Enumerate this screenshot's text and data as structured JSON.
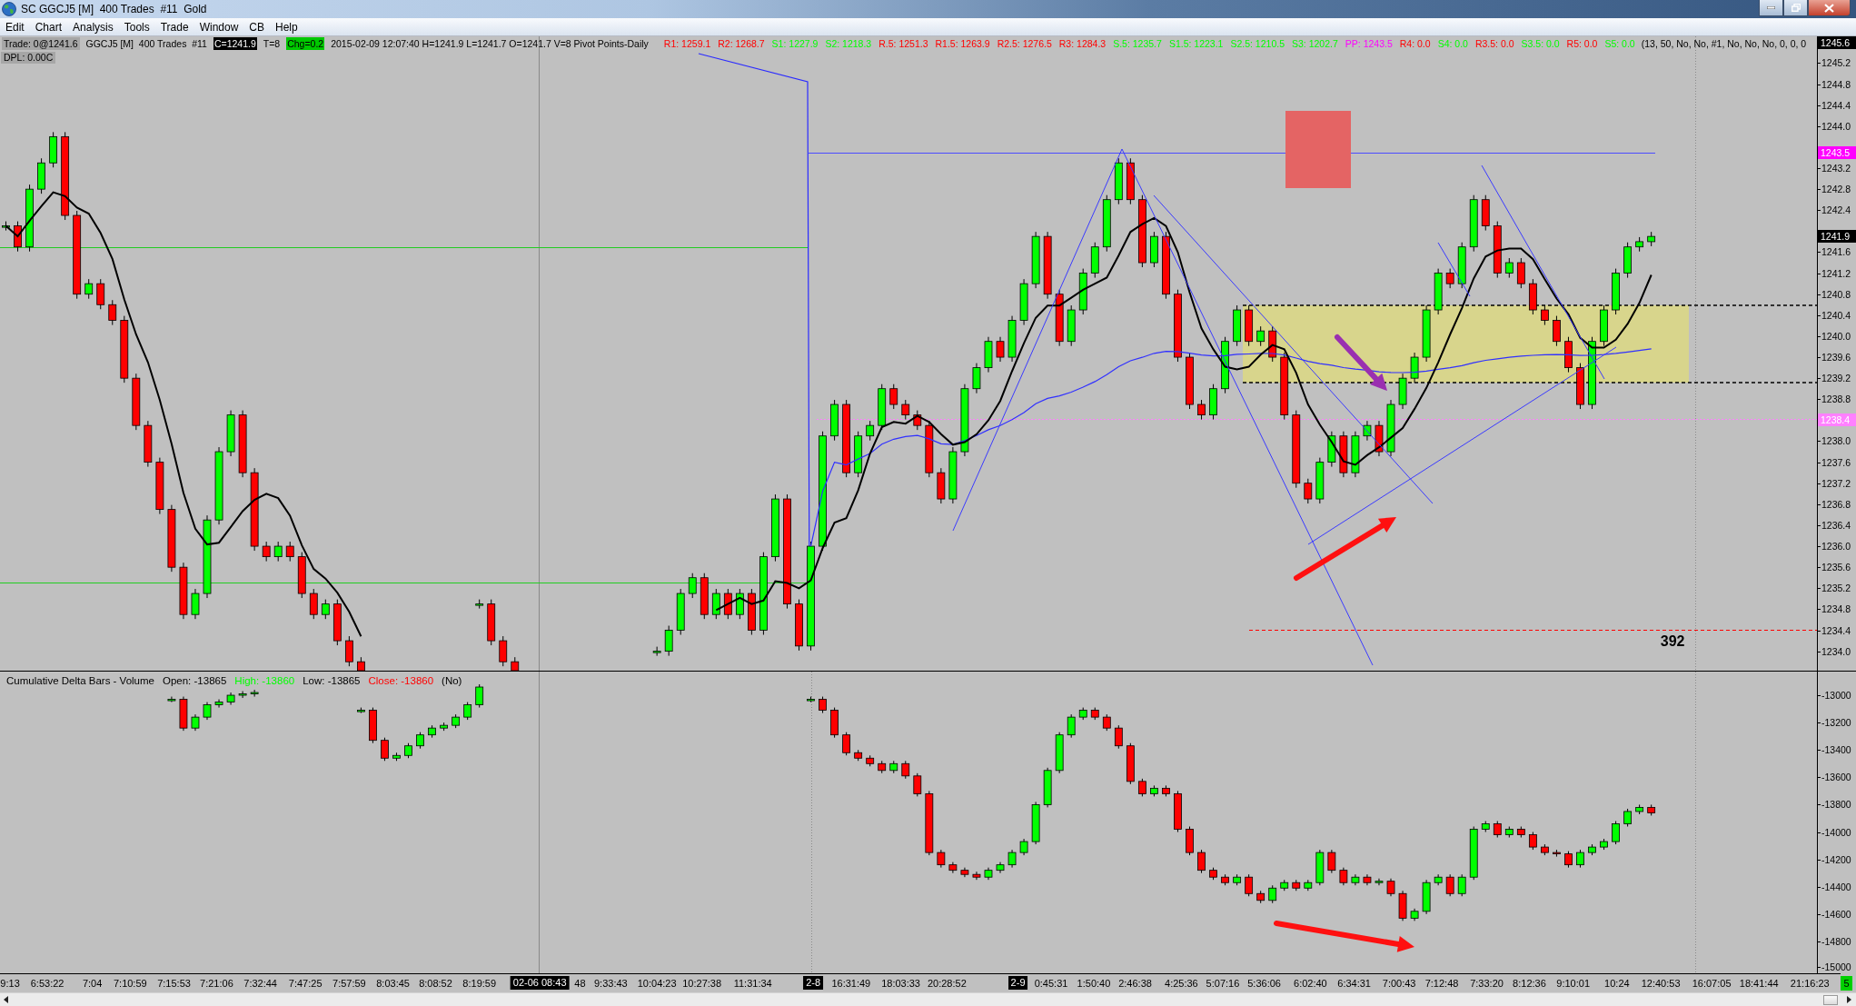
{
  "window": {
    "title": "SC GGCJ5 [M]  400 Trades  #11  Gold"
  },
  "menu": [
    "Edit",
    "Chart",
    "Analysis",
    "Tools",
    "Trade",
    "Window",
    "CB",
    "Help"
  ],
  "info_bar": {
    "fields": [
      {
        "kind": "shaded",
        "text": "Trade: 0@1241.6"
      },
      {
        "kind": "plain",
        "text": "GGCJ5 [M]  400 Trades  #11"
      },
      {
        "kind": "inverse",
        "text": "C=1241.9"
      },
      {
        "kind": "plain",
        "text": "T=8"
      },
      {
        "kind": "highlight",
        "text": "Chg=0.2"
      },
      {
        "kind": "plain",
        "text": "2015-02-09 12:07:40 H=1241.9 L=1241.7 O=1241.7 V=8 Pivot Points-Daily"
      }
    ],
    "pivots": [
      {
        "label": "R1: 1259.1",
        "color": "#ff0000"
      },
      {
        "label": "R2: 1268.7",
        "color": "#ff0000"
      },
      {
        "label": "S1: 1227.9",
        "color": "#00ff00"
      },
      {
        "label": "S2: 1218.3",
        "color": "#00ff00"
      },
      {
        "label": "R.5: 1251.3",
        "color": "#ff0000"
      },
      {
        "label": "R1.5: 1263.9",
        "color": "#ff0000"
      },
      {
        "label": "R2.5: 1276.5",
        "color": "#ff0000"
      },
      {
        "label": "R3: 1284.3",
        "color": "#ff0000"
      },
      {
        "label": "S.5: 1235.7",
        "color": "#00ff00"
      },
      {
        "label": "S1.5: 1223.1",
        "color": "#00ff00"
      },
      {
        "label": "S2.5: 1210.5",
        "color": "#00ff00"
      },
      {
        "label": "S3: 1202.7",
        "color": "#00ff00"
      },
      {
        "label": "PP: 1243.5",
        "color": "#ff00ff"
      },
      {
        "label": "R4: 0.0",
        "color": "#ff0000"
      },
      {
        "label": "S4: 0.0",
        "color": "#00ff00"
      },
      {
        "label": "R3.5: 0.0",
        "color": "#ff0000"
      },
      {
        "label": "S3.5: 0.0",
        "color": "#00ff00"
      },
      {
        "label": "R5: 0.0",
        "color": "#ff0000"
      },
      {
        "label": "S5: 0.0",
        "color": "#00ff00"
      }
    ],
    "inputs": "(13, 50, No, No, #1, No, No, No, 0, 0, 0",
    "dpl": "DPL: 0.00C"
  },
  "price_chart": {
    "axis_labels": [
      "1245.2",
      "1244.8",
      "1244.4",
      "1244.0",
      "1243.2",
      "1242.8",
      "1242.4",
      "1241.6",
      "1241.2",
      "1240.8",
      "1240.4",
      "1240.0",
      "1239.6",
      "1239.2",
      "1238.8",
      "1238.0",
      "1237.6",
      "1237.2",
      "1236.8",
      "1236.4",
      "1236.0",
      "1235.6",
      "1235.2",
      "1234.8",
      "1234.4",
      "1234.0"
    ],
    "axis_markers": [
      {
        "label": "1245.6",
        "color": "#000000"
      },
      {
        "label": "1243.5",
        "color": "#ff00ff"
      },
      {
        "label": "1241.9",
        "color": "#000000"
      },
      {
        "label": "1238.4",
        "color": "#ff80ff"
      }
    ],
    "level_label": "392"
  },
  "delta_panel": {
    "title": "Cumulative Delta Bars - Volume",
    "stats": [
      {
        "label": "Open: -13865",
        "color": "#000000"
      },
      {
        "label": "High: -13860",
        "color": "#00ff00"
      },
      {
        "label": "Low: -13865",
        "color": "#000000"
      },
      {
        "label": "Close: -13860",
        "color": "#ff0000"
      }
    ],
    "flag": "(No)",
    "axis_labels": [
      "-13000",
      "-13200",
      "-13400",
      "-13600",
      "-13800",
      "-14000",
      "-14200",
      "-14400",
      "-14600",
      "-14800",
      "-15000"
    ]
  },
  "time_axis": {
    "labels": [
      "9:13",
      "6:53:22",
      "7:04",
      "7:10:59",
      "7:15:53",
      "7:21:06",
      "7:32:44",
      "7:47:25",
      "7:57:59",
      "8:03:45",
      "8:08:52",
      "8:19:59",
      "48",
      "9:33:43",
      "10:04:23",
      "10:27:38",
      "11:31:34",
      "16:31:49",
      "18:03:33",
      "20:28:52",
      "0:45:31",
      "1:50:40",
      "2:46:38",
      "4:25:36",
      "5:07:16",
      "5:36:06",
      "6:02:40",
      "6:34:31",
      "7:00:43",
      "7:12:48",
      "7:33:20",
      "8:12:36",
      "9:10:01",
      "10:24",
      "12:40:53",
      "16:07:05",
      "18:41:44",
      "21:16:23"
    ],
    "date_tags": [
      "02-06 08:43",
      "2-8",
      "2-9"
    ]
  },
  "corner_badge": {
    "label": "5"
  }
}
